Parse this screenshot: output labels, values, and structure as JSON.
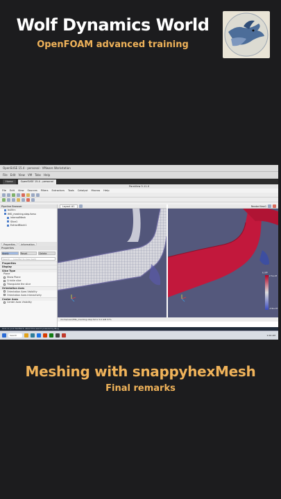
{
  "header": {
    "title": "Wolf Dynamics World",
    "subtitle": "OpenFOAM advanced training"
  },
  "logo": {
    "name": "wolf-dynamics-logo"
  },
  "screenshot": {
    "vm_window_title": "OpenSUSE 15.4 - personal - VMware Workstation",
    "vm_menu": [
      "File",
      "Edit",
      "View",
      "VM",
      "Tabs",
      "Help"
    ],
    "vm_tabs": [
      "Home",
      "OpenSUSE 15.4 - personal"
    ],
    "paraview_title": "ParaView 5.11.0",
    "paraview_menu": [
      "File",
      "Edit",
      "View",
      "Sources",
      "Filters",
      "Extractors",
      "Tools",
      "Catalyst",
      "Macros",
      "Help"
    ],
    "pipeline_header": "Pipeline Browser",
    "pipeline_items": [
      {
        "label": "builtin:",
        "sub": false
      },
      {
        "label": "IMG_meshing.step.fomx",
        "sub": false
      },
      {
        "label": "internalMesh",
        "sub": true
      },
      {
        "label": "Slice1",
        "sub": true
      },
      {
        "label": "ExtractBlock1",
        "sub": true
      }
    ],
    "properties_tabs": [
      "Properties",
      "Information"
    ],
    "properties_header": "Properties",
    "apply_buttons": [
      "Apply",
      "Reset",
      "Delete"
    ],
    "search_placeholder": "Search ... (use Esc to clear text)",
    "sections": [
      {
        "title": "Properties",
        "rows": []
      },
      {
        "title": "Display",
        "rows": []
      },
      {
        "title": "Slice Type",
        "rows": [
          "Plane",
          "Show Plane",
          "Crinkle slice",
          "Triangulate the slice"
        ]
      },
      {
        "title": "Orientation Axes",
        "rows": [
          "Orientation Axes Visibility",
          "Orientation Axes Interactivity"
        ]
      },
      {
        "title": "Center Axes",
        "rows": [
          "Center Axes Visibility"
        ]
      }
    ],
    "layout_tab": "Layout #1",
    "render_view_label": "RenderView1",
    "status_text": "/home/user/IMG_meshing.step.fomx  5.0  GiB  57%",
    "colorbar": {
      "label": "p_rgh",
      "top": "2.7e+03",
      "bottom": "-2.9e+03"
    },
    "notification": "Give us your feedback, about this search powered by Bing",
    "taskbar_search": "Search",
    "clock": "9:44 AM"
  },
  "footer": {
    "title": "Meshing with snappyhexMesh",
    "subtitle": "Final remarks"
  },
  "colors": {
    "accent": "#f0b35a",
    "background": "#1c1c1e",
    "viewport": "#52567a",
    "mesh_surface": "#c2183c"
  }
}
